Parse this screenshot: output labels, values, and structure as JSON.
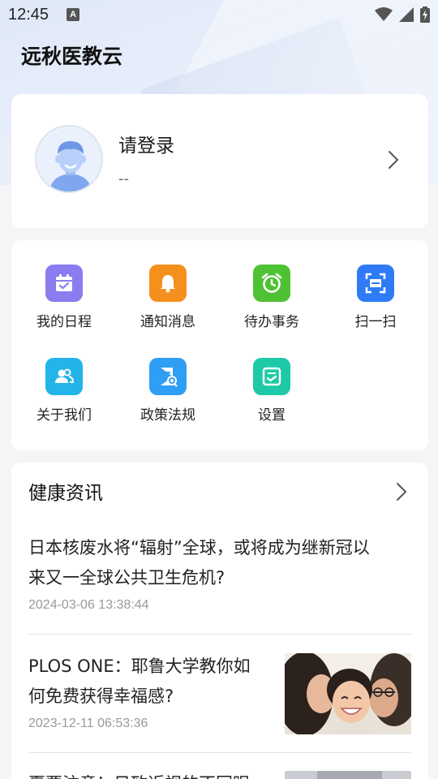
{
  "status_bar": {
    "time": "12:45",
    "notification_icon_letter": "A"
  },
  "app": {
    "title": "远秋医教云"
  },
  "profile": {
    "login_prompt": "请登录",
    "subtitle": "--"
  },
  "menu": [
    {
      "label": "我的日程",
      "icon": "calendar-icon",
      "color": "#8b7cf0"
    },
    {
      "label": "通知消息",
      "icon": "bell-icon",
      "color": "#f5901e"
    },
    {
      "label": "待办事务",
      "icon": "alarm-clock-icon",
      "color": "#4fc234"
    },
    {
      "label": "扫一扫",
      "icon": "scan-icon",
      "color": "#2f7bf5"
    },
    {
      "label": "关于我们",
      "icon": "users-icon",
      "color": "#23b4ea"
    },
    {
      "label": "政策法规",
      "icon": "policy-document-icon",
      "color": "#2f9ef5"
    },
    {
      "label": "设置",
      "icon": "settings-check-icon",
      "color": "#1ec9a8"
    }
  ],
  "news": {
    "heading": "健康资讯",
    "items": [
      {
        "title_line1": "日本核废水将“辐射”全球，或将成为继新冠以",
        "title_line2": "来又一全球公共卫生危机?",
        "date": "2024-03-06 13:38:44"
      },
      {
        "title_line1": "PLOS ONE：耶鲁大学教你如",
        "title_line2": "何免费获得幸福感?",
        "date": "2023-12-11 06:53:36"
      },
      {
        "title_line1": "夏要注意！日致近视的不同眼",
        "title_line2": "",
        "date": ""
      }
    ]
  }
}
